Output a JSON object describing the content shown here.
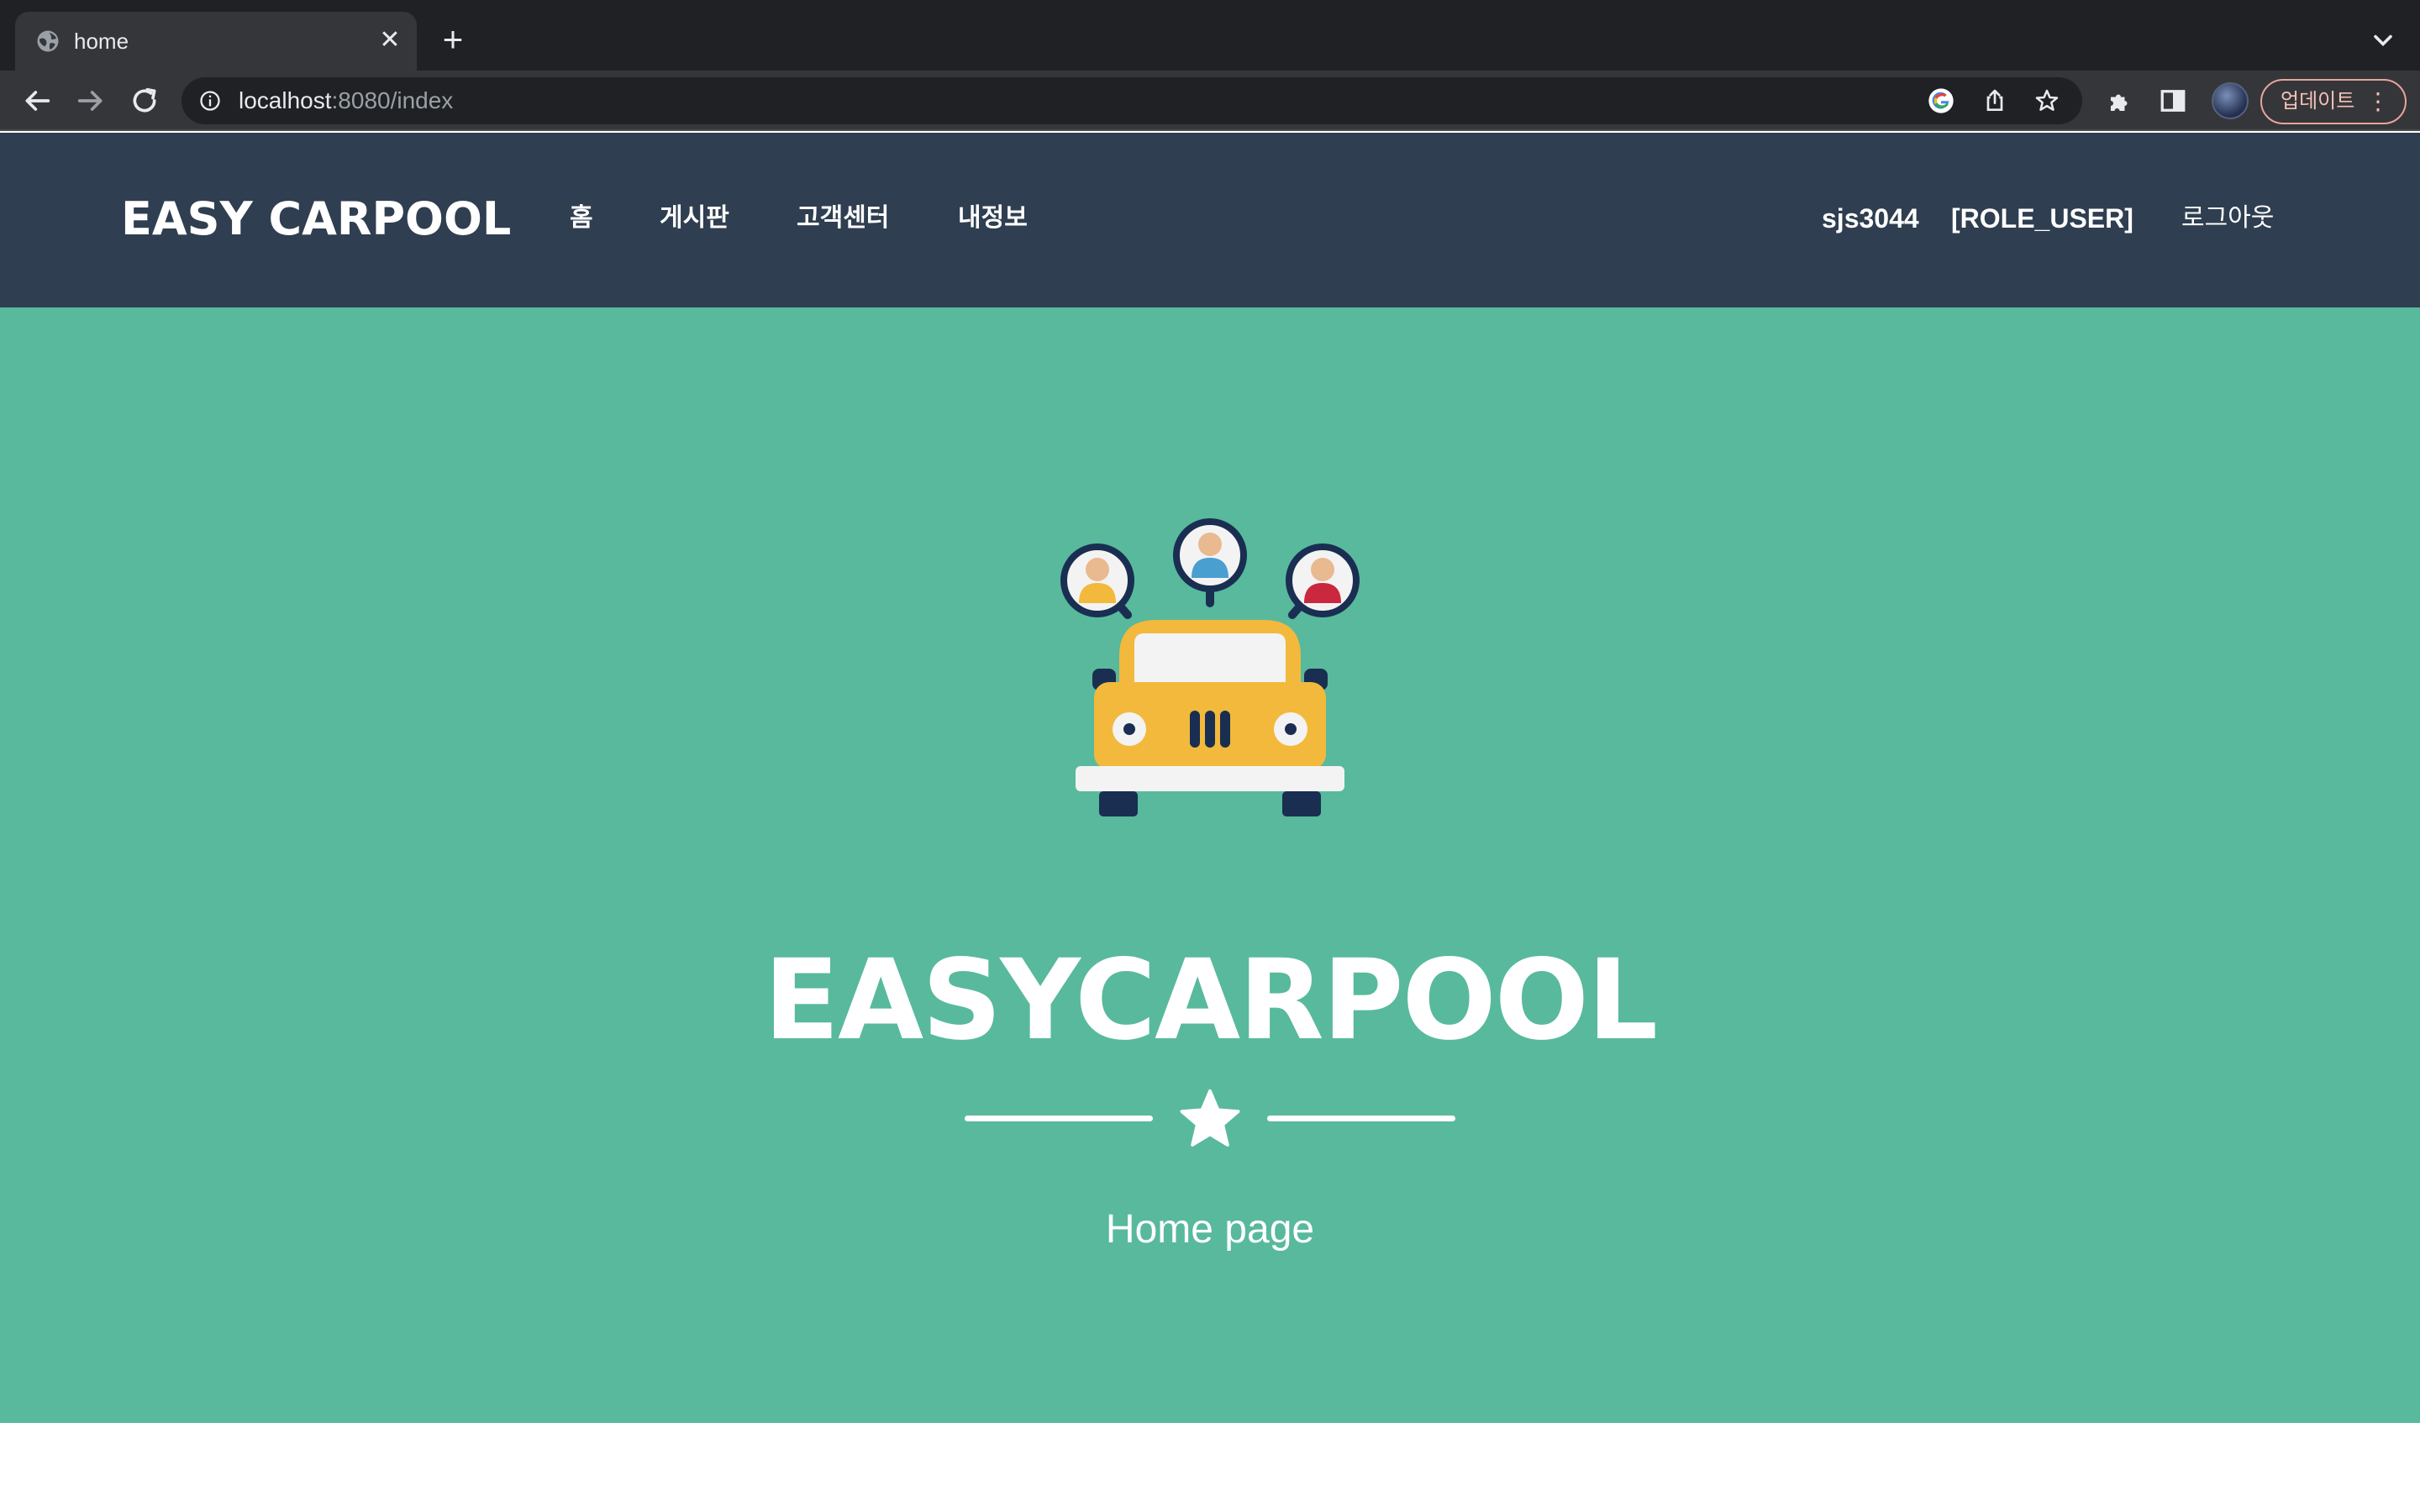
{
  "browser": {
    "tab_title": "home",
    "url_host": "localhost",
    "url_rest": ":8080/index",
    "update_label": "업데이트",
    "update_menu_glyph": "⋮",
    "new_tab_glyph": "+",
    "close_glyph": "✕",
    "icons": [
      "globe-icon",
      "back-icon",
      "forward-icon",
      "reload-icon",
      "info-icon",
      "google-icon",
      "share-icon",
      "bookmark-star-icon",
      "extensions-icon",
      "side-panel-icon",
      "profile-avatar",
      "tab-search-icon"
    ]
  },
  "navbar": {
    "brand": "EASY CARPOOL",
    "menu": [
      {
        "label": "홈"
      },
      {
        "label": "게시판"
      },
      {
        "label": "고객센터"
      },
      {
        "label": "내정보"
      }
    ],
    "username": "sjs3044",
    "role": "[ROLE_USER]",
    "logout": "로그아웃"
  },
  "hero": {
    "title": "EASYCARPOOL",
    "subtitle": "Home page",
    "illustration": "carpool-car-icon",
    "divider_icon": "star-icon"
  },
  "colors": {
    "navbar_bg": "#2f3e50",
    "hero_bg": "#58b99d",
    "car_yellow": "#f2b93c",
    "navy": "#1a2e52"
  }
}
